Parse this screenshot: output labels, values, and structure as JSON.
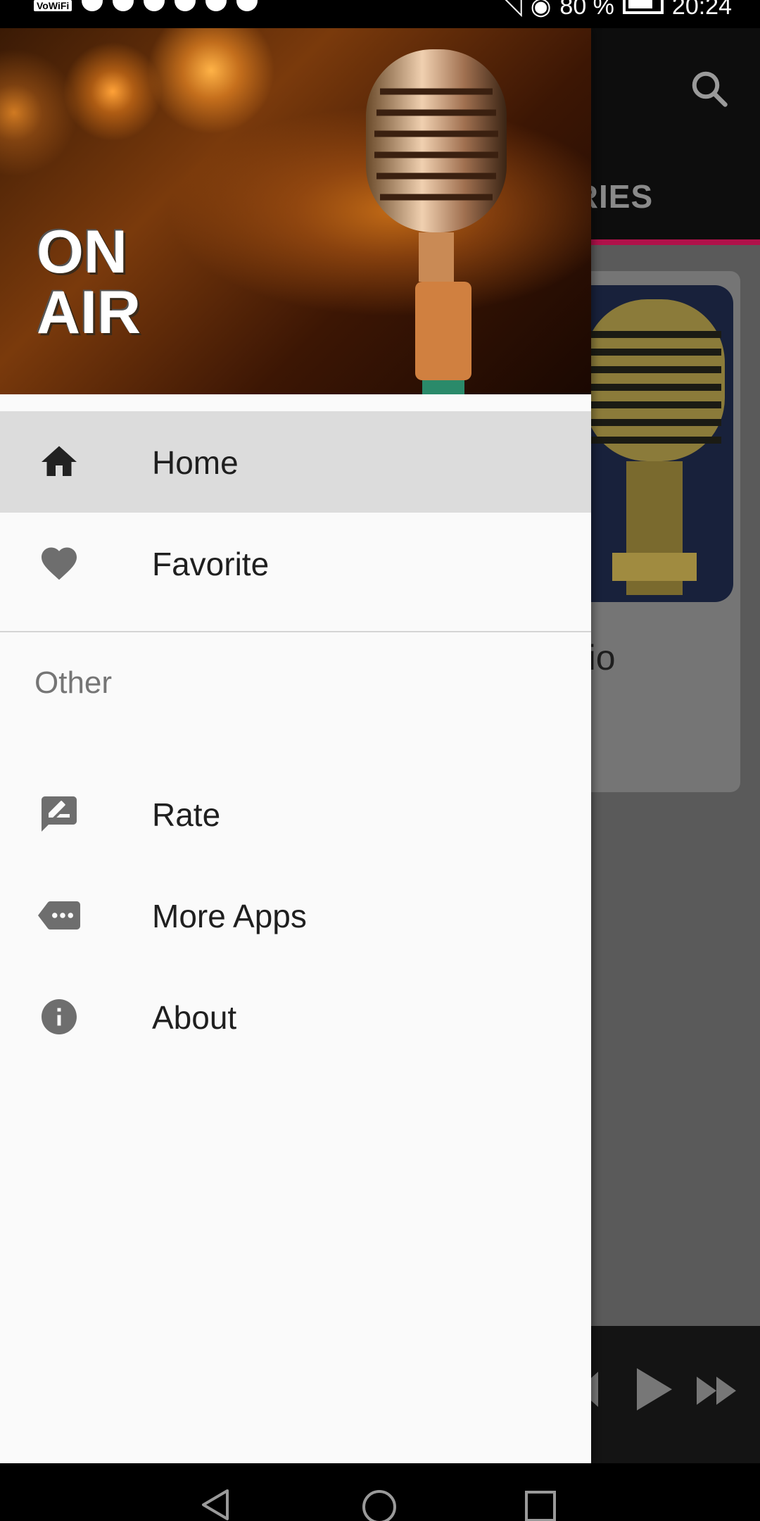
{
  "status_bar": {
    "left_chip": "VoWiFi",
    "battery": "80 %",
    "time": "20:24"
  },
  "background_app": {
    "tab_label": "ORIES",
    "card_title": "adio",
    "accent_color": "#b0124a"
  },
  "drawer": {
    "header": {
      "line1": "ON",
      "line2": "AIR"
    },
    "primary_items": [
      {
        "label": "Home",
        "icon": "home-icon",
        "active": true
      },
      {
        "label": "Favorite",
        "icon": "heart-icon",
        "active": false
      }
    ],
    "section_title": "Other",
    "secondary_items": [
      {
        "label": "Rate",
        "icon": "rate-review-icon"
      },
      {
        "label": "More Apps",
        "icon": "more-apps-icon"
      },
      {
        "label": "About",
        "icon": "info-icon"
      }
    ]
  },
  "navigation_bar": {
    "buttons": [
      "back-icon",
      "home-circle-icon",
      "recents-icon"
    ]
  }
}
